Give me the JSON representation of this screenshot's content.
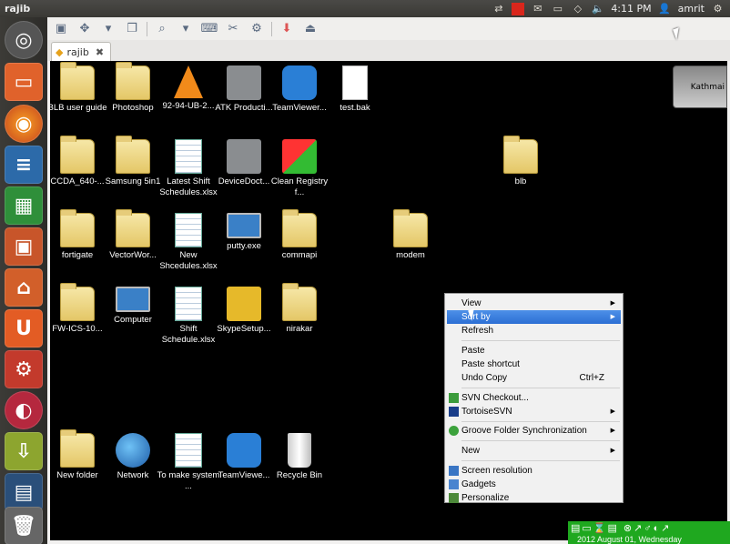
{
  "topbar": {
    "title": "rajib",
    "time": "4:11 PM",
    "user": "amrit",
    "tray_icons": [
      "network-sync-icon",
      "red-app-icon",
      "mail-icon",
      "battery-icon",
      "wifi-icon",
      "volume-icon"
    ]
  },
  "launcher": {
    "items": [
      "ubuntu-home-icon",
      "files-icon",
      "firefox-icon",
      "writer-icon",
      "calc-icon",
      "impress-icon",
      "software-center-icon",
      "ubuntu-one-icon",
      "settings-icon",
      "remote-desktop-icon",
      "installer-icon",
      "workspace-icon",
      "trash-icon"
    ]
  },
  "tab": {
    "label": "rajib"
  },
  "desktop_icons": [
    {
      "label": "BLB user guide",
      "type": "folder"
    },
    {
      "label": "Photoshop",
      "type": "folder"
    },
    {
      "label": "92-94-UB-2...",
      "type": "cone"
    },
    {
      "label": "ATK Producti...",
      "type": "gray-box"
    },
    {
      "label": "TeamViewer...",
      "type": "blue-sq"
    },
    {
      "label": "test.bak",
      "type": "doc"
    },
    {
      "label": "CCDA_640-...",
      "type": "folder"
    },
    {
      "label": "Samsung 5in1",
      "type": "folder"
    },
    {
      "label": "Latest Shift Schedules.xlsx",
      "type": "sheet"
    },
    {
      "label": "DeviceDoct...",
      "type": "gray-box"
    },
    {
      "label": "Clean Registry f...",
      "type": "win-flag"
    },
    {
      "label": "blb",
      "type": "folder"
    },
    {
      "label": "fortigate",
      "type": "folder"
    },
    {
      "label": "VectorWor...",
      "type": "folder"
    },
    {
      "label": "New Shcedules.xlsx",
      "type": "sheet"
    },
    {
      "label": "putty.exe",
      "type": "monitor"
    },
    {
      "label": "commapi",
      "type": "folder"
    },
    {
      "label": "modem",
      "type": "folder"
    },
    {
      "label": "FW-ICS-10...",
      "type": "folder"
    },
    {
      "label": "Computer",
      "type": "monitor"
    },
    {
      "label": "Shift Schedule.xlsx",
      "type": "sheet"
    },
    {
      "label": "SkypeSetup...",
      "type": "gray-box"
    },
    {
      "label": "nirakar",
      "type": "folder"
    },
    {
      "label": "New folder",
      "type": "folder"
    },
    {
      "label": "Network",
      "type": "globe"
    },
    {
      "label": "To make system ...",
      "type": "sheet"
    },
    {
      "label": "TeamViewe...",
      "type": "blue-sq"
    },
    {
      "label": "Recycle Bin",
      "type": "bin"
    }
  ],
  "thumbnail": {
    "label": "Kathmai"
  },
  "context_menu": {
    "view": "View",
    "sort_by": "Sort by",
    "refresh": "Refresh",
    "paste": "Paste",
    "paste_shortcut": "Paste shortcut",
    "undo_copy": "Undo Copy",
    "undo_shortcut": "Ctrl+Z",
    "svn_checkout": "SVN Checkout...",
    "tortoise": "TortoiseSVN",
    "groove": "Groove Folder Synchronization",
    "new": "New",
    "screen_resolution": "Screen resolution",
    "gadgets": "Gadgets",
    "personalize": "Personalize"
  },
  "statusbar": {
    "date": "2012 August 01, Wednesday"
  },
  "colors": {
    "highlight": "#2c6fd4",
    "statusbar": "#1fa81f",
    "launcher": "#3c3b37"
  }
}
